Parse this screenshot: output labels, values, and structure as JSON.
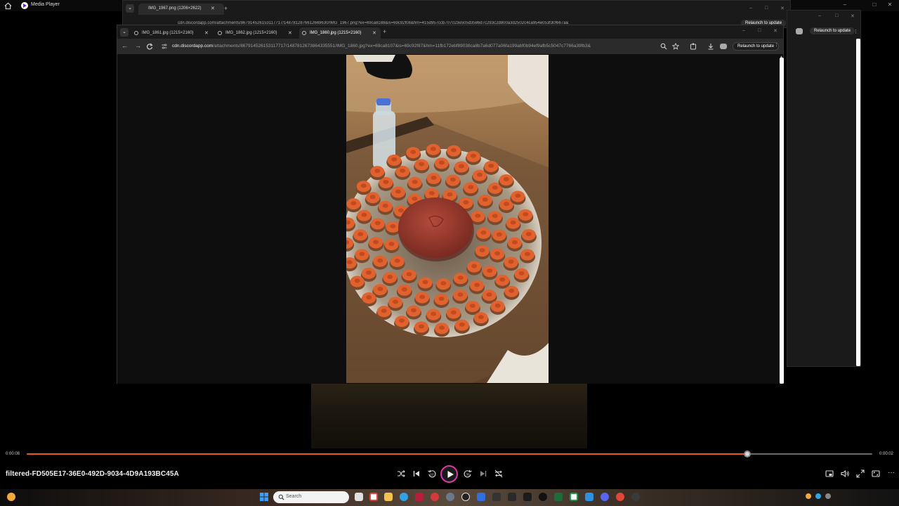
{
  "media_player": {
    "app_title": "Media Player",
    "file_title": "filtered-FD505E17-36E0-492D-9034-4D9A193BC45A",
    "time_elapsed": "0:00:08",
    "time_remaining": "0:00:02",
    "progress_fraction": 0.852,
    "accent_color": "#e85a1a",
    "play_ring_color": "#d63aa6"
  },
  "browser_back": {
    "tab_title": "IMG_1967.png (1206×2622)",
    "url": "cdn.discordapp.com/attachments/867914526153117717/1487812876612669630/IMG_1967.png?ex=69ca8188&is=69c92f08&hm=415d957ccb707023e505d3586d7c293c2d800a3d2502c4ca954e053f30f667a&",
    "relaunch_label": "Relaunch to update"
  },
  "browser_right": {
    "relaunch_label": "Relaunch to update"
  },
  "browser_front": {
    "tabs": [
      {
        "title": "IMG_1861.jpg (1215×2160)",
        "active": false
      },
      {
        "title": "IMG_1862.jpg (1215×2160)",
        "active": false
      },
      {
        "title": "IMG_1860.jpg (1215×2160)",
        "active": true
      }
    ],
    "url_host": "cdn.discordapp.com",
    "url_path": "/attachments/867914526153117717/1487812673864335551/IMG_1860.jpg?ex=69ca8107&is=69c92f87&hm=11fb172ebf89038ca8b7a6d077a06fa199abf0b94ef9afb5c5047c7766a39fb3&",
    "relaunch_label": "Relaunch to update"
  },
  "taskbar": {
    "search_placeholder": "Search"
  },
  "icons": {
    "home": "home-icon",
    "shuffle": "shuffle-icon",
    "previous": "previous-icon",
    "rewind": "rewind-10-icon",
    "play": "play-icon",
    "forward": "forward-30-icon",
    "next": "next-icon",
    "repeat": "repeat-icon",
    "miniplayer": "miniplayer-icon",
    "volume": "volume-icon",
    "fullscreen": "fullscreen-icon",
    "more": "more-icon"
  }
}
